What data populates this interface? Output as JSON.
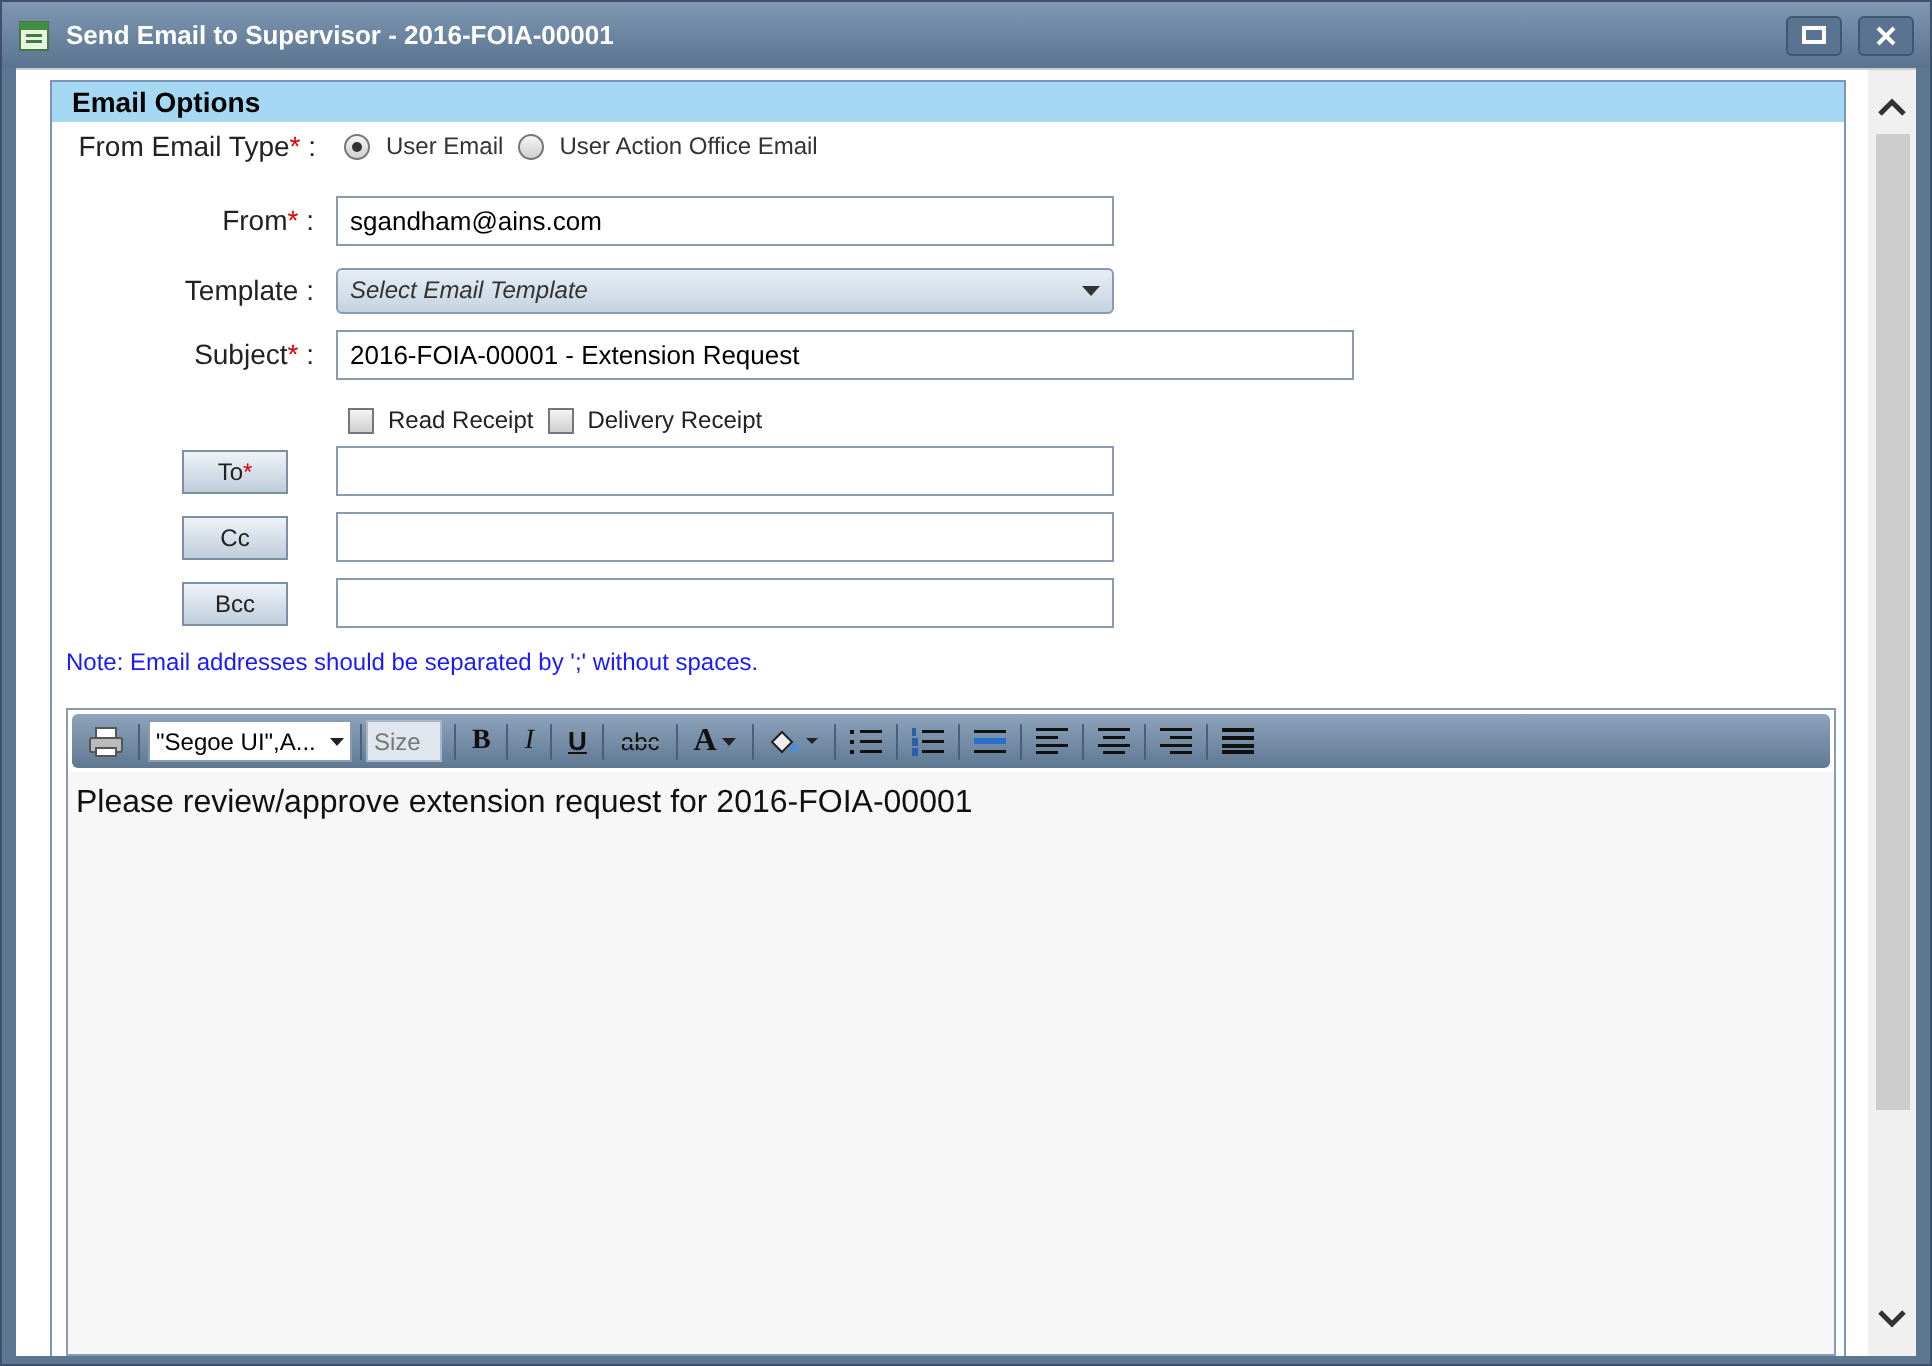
{
  "window": {
    "title": "Send Email to Supervisor - 2016-FOIA-00001"
  },
  "section": {
    "title": "Email Options"
  },
  "from_email_type": {
    "label": "From Email Type",
    "mark": "*",
    "suffix": " :",
    "options": [
      {
        "label": "User Email",
        "selected": true
      },
      {
        "label": "User Action Office Email",
        "selected": false
      }
    ]
  },
  "from": {
    "label": "From",
    "mark": "*",
    "suffix": " :",
    "value": "sgandham@ains.com"
  },
  "template": {
    "label": "Template",
    "suffix": " :",
    "placeholder": "Select Email Template"
  },
  "subject": {
    "label": "Subject",
    "mark": "*",
    "suffix": " :",
    "value": "2016-FOIA-00001 - Extension Request"
  },
  "receipts": [
    {
      "label": "Read Receipt",
      "checked": false
    },
    {
      "label": "Delivery Receipt",
      "checked": false
    }
  ],
  "recipients": [
    {
      "label": "To",
      "mark": "*"
    },
    {
      "label": "Cc"
    },
    {
      "label": "Bcc"
    }
  ],
  "note": "Note: Email addresses should be separated by ';' without spaces.",
  "toolbar": [
    {
      "kind": "print"
    },
    {
      "kind": "font",
      "value": "\"Segoe UI\",A..."
    },
    {
      "kind": "size",
      "placeholder": "Size"
    },
    {
      "kind": "bold",
      "label": "B"
    },
    {
      "kind": "italic",
      "label": "I"
    },
    {
      "kind": "underline",
      "label": "U"
    },
    {
      "kind": "strike",
      "label": "abc"
    },
    {
      "kind": "color",
      "label": "A"
    },
    {
      "kind": "fill"
    },
    {
      "kind": "bullets"
    },
    {
      "kind": "numbering"
    },
    {
      "kind": "rule"
    },
    {
      "kind": "left"
    },
    {
      "kind": "center"
    },
    {
      "kind": "right"
    },
    {
      "kind": "justify"
    }
  ],
  "editor": {
    "body": "Please review/approve extension request for 2016-FOIA-00001"
  }
}
